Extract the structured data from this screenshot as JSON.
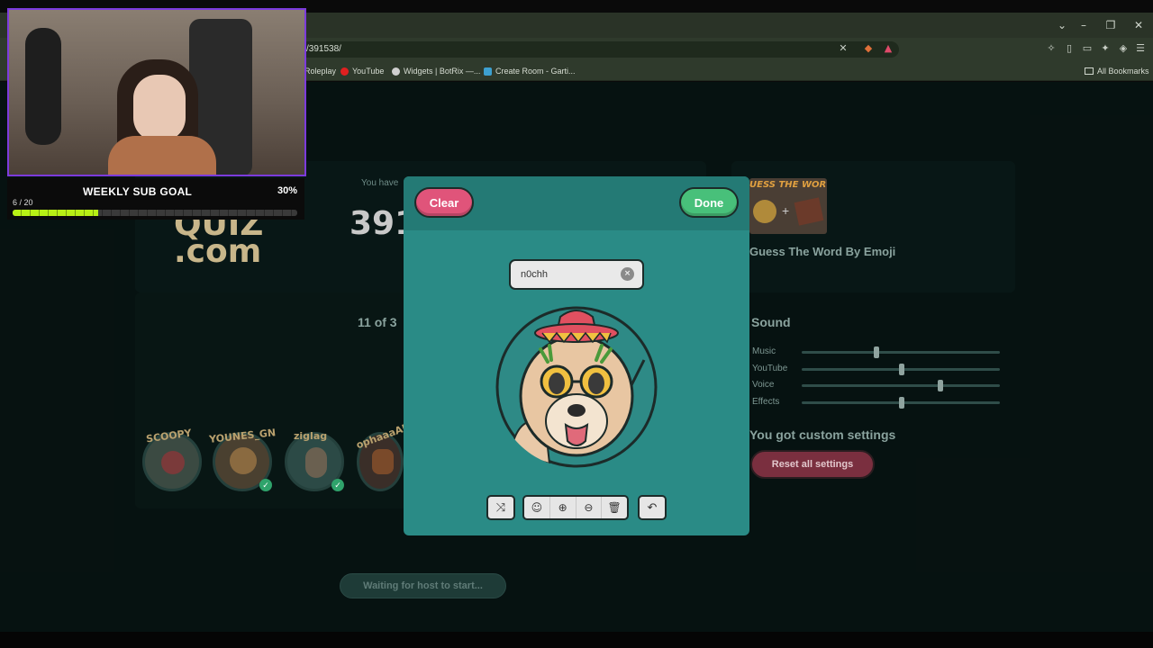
{
  "browser": {
    "url": "/391538/",
    "bookmarks": [
      {
        "label": "Roleplay",
        "color": "#7b7b7b"
      },
      {
        "label": "YouTube",
        "color": "#e02020"
      },
      {
        "label": "Widgets | BotRix —...",
        "color": "#cfcfcf"
      },
      {
        "label": "Create Room - Garti...",
        "color": "#3da0d0"
      }
    ],
    "all_bookmarks": "All Bookmarks"
  },
  "background": {
    "you_have_label": "You have",
    "room_number": "391",
    "logo": "QUIZ\n.com",
    "quiz_title": "Guess The Word By Emoji",
    "quiz_banner": "UESS THE WOR",
    "players_count": "11 of 3",
    "players": [
      {
        "name": "SCOOPY",
        "ready": false
      },
      {
        "name": "YOUNES_GN",
        "ready": true
      },
      {
        "name": "ziglag",
        "ready": true
      },
      {
        "name": "ophaaaAB",
        "ready": false
      }
    ],
    "sound": {
      "title": "Sound",
      "sliders": [
        {
          "label": "Music",
          "level": 0.37
        },
        {
          "label": "YouTube",
          "level": 0.5
        },
        {
          "label": "Voice",
          "level": 0.7
        },
        {
          "label": "Effects",
          "level": 0.5
        }
      ]
    },
    "custom_settings": "You got custom settings",
    "reset_label": "Reset all settings",
    "waiting_label": "Waiting for host to start..."
  },
  "modal": {
    "clear_label": "Clear",
    "done_label": "Done",
    "name_value": "n0chh",
    "clear_x": "×",
    "tools": {
      "shuffle": "⤨",
      "emoji": "☺",
      "zoom_in": "⊕",
      "zoom_out": "⊖",
      "delete": "🗑",
      "undo": "↶"
    }
  },
  "overlay": {
    "goal_title": "WEEKLY SUB GOAL",
    "goal_percent": "30%",
    "goal_count": "6 / 20",
    "goal_progress": 0.3,
    "accent": "#b8f015",
    "frame_color": "#7c3bdc"
  },
  "colors": {
    "modal": "#2a8b86",
    "clear": "#e0547a",
    "done": "#48c07a",
    "page_bg": "#12302d"
  }
}
